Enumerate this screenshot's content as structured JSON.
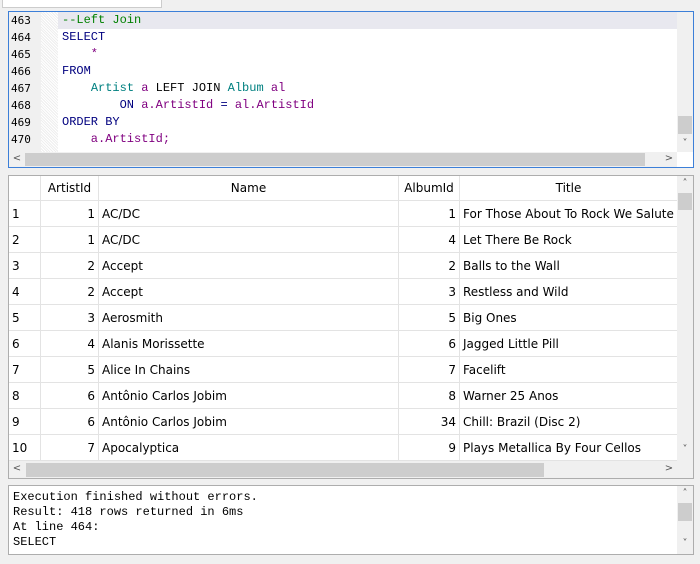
{
  "editor": {
    "line_numbers": [
      "463",
      "464",
      "465",
      "466",
      "467",
      "468",
      "469",
      "470"
    ],
    "lines": [
      [
        {
          "t": "--Left Join",
          "c": "comment"
        }
      ],
      [
        {
          "t": "SELECT",
          "c": "kw"
        }
      ],
      [
        {
          "t": "    *",
          "c": "ident"
        }
      ],
      [
        {
          "t": "FROM",
          "c": "kw"
        }
      ],
      [
        {
          "t": "    ",
          "c": "ident"
        },
        {
          "t": "Artist",
          "c": "table"
        },
        {
          "t": " a ",
          "c": "ident"
        },
        {
          "t": "LEFT JOIN",
          "c": "kw2"
        },
        {
          "t": " ",
          "c": "ident"
        },
        {
          "t": "Album",
          "c": "table"
        },
        {
          "t": " al",
          "c": "ident"
        }
      ],
      [
        {
          "t": "        ",
          "c": "ident"
        },
        {
          "t": "ON",
          "c": "kw"
        },
        {
          "t": " a.ArtistId ",
          "c": "ident"
        },
        {
          "t": "=",
          "c": "kw"
        },
        {
          "t": " al.ArtistId",
          "c": "ident"
        }
      ],
      [
        {
          "t": "ORDER BY",
          "c": "kw"
        }
      ],
      [
        {
          "t": "    a.ArtistId;",
          "c": "ident"
        }
      ]
    ],
    "colors": {
      "comment": "#008000",
      "kw": "#00007f",
      "kw2": "#000000",
      "table": "#008080",
      "ident": "#800080"
    }
  },
  "grid": {
    "columns": [
      "ArtistId",
      "Name",
      "AlbumId",
      "Title"
    ],
    "rows": [
      [
        "1",
        "1",
        "AC/DC",
        "1",
        "For Those About To Rock We Salute You"
      ],
      [
        "2",
        "1",
        "AC/DC",
        "4",
        "Let There Be Rock"
      ],
      [
        "3",
        "2",
        "Accept",
        "2",
        "Balls to the Wall"
      ],
      [
        "4",
        "2",
        "Accept",
        "3",
        "Restless and Wild"
      ],
      [
        "5",
        "3",
        "Aerosmith",
        "5",
        "Big Ones"
      ],
      [
        "6",
        "4",
        "Alanis Morissette",
        "6",
        "Jagged Little Pill"
      ],
      [
        "7",
        "5",
        "Alice In Chains",
        "7",
        "Facelift"
      ],
      [
        "8",
        "6",
        "Antônio Carlos Jobim",
        "8",
        "Warner 25 Anos"
      ],
      [
        "9",
        "6",
        "Antônio Carlos Jobim",
        "34",
        "Chill: Brazil (Disc 2)"
      ],
      [
        "10",
        "7",
        "Apocalyptica",
        "9",
        "Plays Metallica By Four Cellos"
      ]
    ]
  },
  "messages": [
    "Execution finished without errors.",
    "Result: 418 rows returned in 6ms",
    "At line 464:",
    "SELECT"
  ],
  "icons": {
    "up": "˄",
    "down": "˅",
    "left": "<",
    "right": ">"
  }
}
